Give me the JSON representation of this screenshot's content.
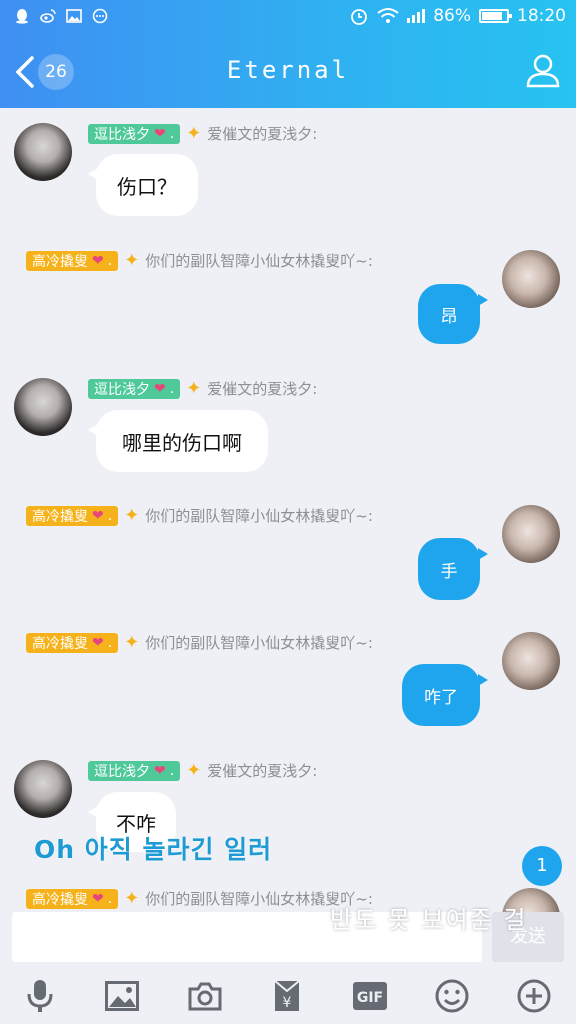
{
  "status_bar": {
    "battery": "86%",
    "time": "18:20",
    "icons": [
      "qq-icon",
      "weibo-icon",
      "image-icon",
      "message-icon",
      "alarm-icon",
      "wifi-icon",
      "signal-icon",
      "battery-icon"
    ]
  },
  "header": {
    "back_count": "26",
    "title": "Eternal"
  },
  "messages": [
    {
      "side": "left",
      "tag": "逗比浅夕",
      "nickname": "爱催文的夏浅夕:",
      "text": "伤口？"
    },
    {
      "side": "right",
      "tag": "高冷撬叟",
      "nickname": "你们的副队智障小仙女林撬叟吖~:",
      "text": "昂"
    },
    {
      "side": "left",
      "tag": "逗比浅夕",
      "nickname": "爱催文的夏浅夕:",
      "text": "哪里的伤口啊"
    },
    {
      "side": "right",
      "tag": "高冷撬叟",
      "nickname": "你们的副队智障小仙女林撬叟吖~:",
      "text": "手"
    },
    {
      "side": "right",
      "tag": "高冷撬叟",
      "nickname": "你们的副队智障小仙女林撬叟吖~:",
      "text": "咋了"
    },
    {
      "side": "left",
      "tag": "逗比浅夕",
      "nickname": "爱催文的夏浅夕:",
      "text": "不咋"
    },
    {
      "side": "right",
      "tag": "高冷撬叟",
      "nickname": "你们的副队智障小仙女林撬叟吖~:",
      "text": ""
    }
  ],
  "overlay": {
    "lyric_line1": "Oh 아직 놀라긴 일러",
    "lyric_line2": "반도 못 보여준 걸"
  },
  "scroll_badge": "1",
  "input": {
    "value": "",
    "send_label": "发送"
  },
  "toolbar": [
    "microphone-icon",
    "image-icon",
    "camera-icon",
    "red-packet-icon",
    "gif-icon",
    "emoji-icon",
    "plus-icon"
  ],
  "toolbar_gif_label": "GIF",
  "colors": {
    "header_start": "#3f8ff2",
    "header_end": "#27c3f1",
    "outgoing_bubble": "#1fa5ee",
    "tag_green": "#4fc99a",
    "tag_yellow": "#f6b21a"
  }
}
